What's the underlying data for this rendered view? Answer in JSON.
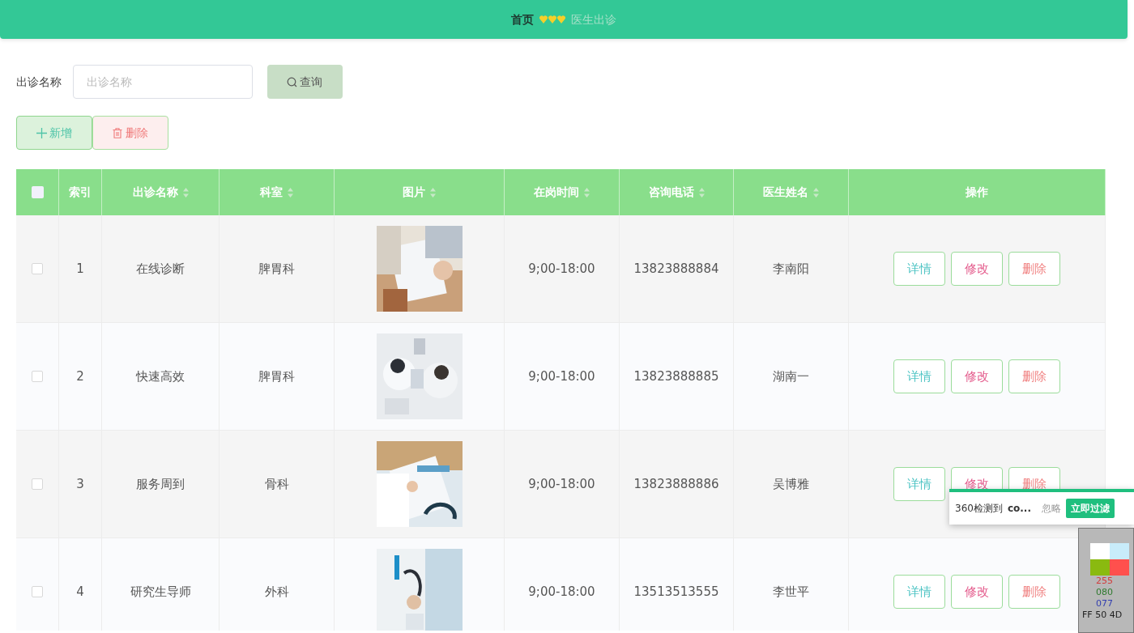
{
  "breadcrumb": {
    "home": "首页",
    "current": "医生出诊"
  },
  "search": {
    "label": "出诊名称",
    "placeholder": "出诊名称",
    "button": "查询"
  },
  "actions": [
    {
      "kind": "add",
      "label": "新增"
    },
    {
      "kind": "delete",
      "label": "删除"
    }
  ],
  "table": {
    "select_all": {
      "checked": false
    },
    "columns": [
      {
        "label": "索引",
        "sortable": false
      },
      {
        "label": "出诊名称",
        "sortable": true
      },
      {
        "label": "科室",
        "sortable": true
      },
      {
        "label": "图片",
        "sortable": true
      },
      {
        "label": "在岗时间",
        "sortable": true
      },
      {
        "label": "咨询电话",
        "sortable": true
      },
      {
        "label": "医生姓名",
        "sortable": true
      },
      {
        "label": "操作",
        "sortable": false
      }
    ],
    "rows": [
      {
        "selected": false,
        "index": "1",
        "name": "在线诊断",
        "department": "脾胃科",
        "picture": {
          "kind": "picture"
        },
        "hours": "9;00-18:00",
        "phone": "13823888884",
        "doctor": "李南阳",
        "buttons": [
          "详情",
          "修改",
          "删除"
        ]
      },
      {
        "selected": false,
        "index": "2",
        "name": "快速高效",
        "department": "脾胃科",
        "picture": {
          "kind": "picture"
        },
        "hours": "9;00-18:00",
        "phone": "13823888885",
        "doctor": "湖南一",
        "buttons": [
          "详情",
          "修改",
          "删除"
        ]
      },
      {
        "selected": false,
        "index": "3",
        "name": "服务周到",
        "department": "骨科",
        "picture": {
          "kind": "picture"
        },
        "hours": "9;00-18:00",
        "phone": "13823888886",
        "doctor": "吴博雅",
        "buttons": [
          "详情",
          "修改",
          "删除"
        ]
      },
      {
        "selected": false,
        "index": "4",
        "name": "研究生导师",
        "department": "外科",
        "picture": {
          "kind": "picture"
        },
        "hours": "9;00-18:00",
        "phone": "13513513555",
        "doctor": "李世平",
        "buttons": [
          "详情",
          "修改",
          "删除"
        ]
      }
    ]
  },
  "notification": {
    "text": "360检测到",
    "detail": "co...",
    "ignore": "忽略",
    "action": "立即过滤"
  },
  "color_picker": {
    "red": "255",
    "green": "080",
    "blue": "077",
    "hex": "FF 50 4D"
  }
}
